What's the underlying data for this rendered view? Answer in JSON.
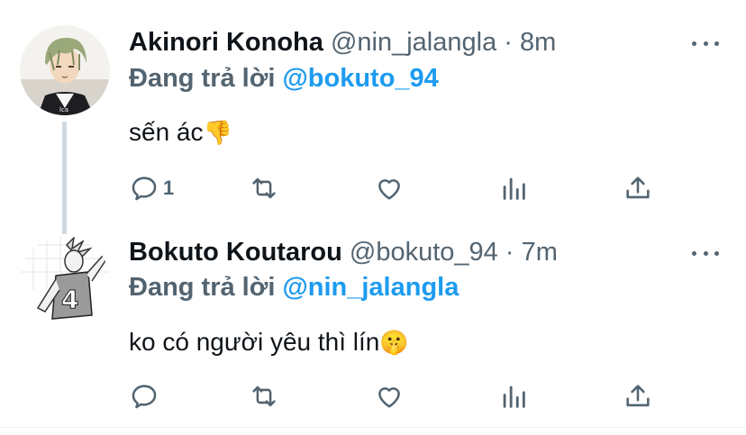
{
  "tweets": [
    {
      "author_name": "Akinori Konoha",
      "handle": "@nin_jalangla",
      "separator": "·",
      "time": "8m",
      "reply_prefix": "Đang trả lời",
      "reply_to": "@bokuto_94",
      "text": "sến ác",
      "emoji": "👎",
      "reply_count": "1",
      "avatar_icon": "avatar-konoha"
    },
    {
      "author_name": "Bokuto Koutarou",
      "handle": "@bokuto_94",
      "separator": "·",
      "time": "7m",
      "reply_prefix": "Đang trả lời",
      "reply_to": "@nin_jalangla",
      "text": "ko có người yêu thì lín",
      "emoji": "🤫",
      "reply_count": "",
      "avatar_icon": "avatar-bokuto"
    }
  ],
  "colors": {
    "text": "#0f1419",
    "secondary": "#536471",
    "accent": "#1d9bf0",
    "thread_line": "#cfd9de"
  }
}
